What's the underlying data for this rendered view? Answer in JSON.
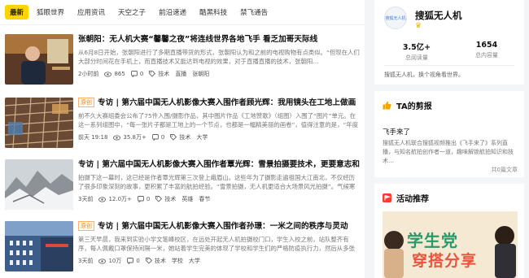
{
  "tabs": [
    {
      "label": "最新"
    },
    {
      "label": "狐眼世界"
    },
    {
      "label": "应用资讯"
    },
    {
      "label": "天空之子"
    },
    {
      "label": "前沿速递"
    },
    {
      "label": "酷黑科技"
    },
    {
      "label": "禁飞通告"
    }
  ],
  "articles": [
    {
      "badge": "",
      "title": "张朝阳：无人机大赛“馨馨之夜”将连线世界各地飞手 看乏加哥天际线",
      "summary": "从6月8日开始，张朝阳进行了多期直播带货的形式，张朝阳认为和之前的电视购物有点类似。“但现在人们大部分时间花在手机上，而直播技术又能达到电视的效果，对于直播直播的技术，张朝阳…",
      "time": "2小时前",
      "views": "865",
      "comments": "0",
      "tags": [
        "技术",
        "直播",
        "张朝阳"
      ]
    },
    {
      "badge": "原创",
      "title": "专访 | 第六届中国无人机影像大赛入围作者顾光辉：我用镜头在工地上做画",
      "summary": "前不久大赛组委会公布了75件入围/摄影作品，其中图片作品《工地赞歌》（组图）入围了“图片”单元。在这一系列组图中，“每一张片子都是工地上的一个节点，也都是一幅精美丽的画卷”，值得注意的是，“年度飞…",
      "time": "前天 19:18",
      "views": "35.8万+",
      "comments": "0",
      "tags": [
        "技术",
        "大学"
      ]
    },
    {
      "badge": "",
      "title": "专访 | 第六届中国无人机影像大赛入围作者覃光辉：雪景拍摄要技术，更要意志和毅力",
      "summary": "拍摄下这一幕时，这已经是作者覃光辉第三次登上峨眉山。这些年为了摄影走遍祖国大江南北，不仅经历了很多印象深刻的故事，更积累了丰富的航拍经验。“雪景拍摄，无人机更适合大场景风光拍摄”。气候寒冷时航拍要…",
      "time": "3天前",
      "views": "12.0万+",
      "comments": "0",
      "tags": [
        "技术",
        "英雄",
        "春节"
      ]
    },
    {
      "badge": "原创",
      "title": "专访 | 第六届中国无人机影像大赛入围作者孙璟：一米之间的秩序与灵动",
      "summary": "第三天早晨，我来到实验小学文笔峰校区，在远处开起无人机拍摄校门口，学生入校之前，站队整齐有序，每人佩戴口罩保持间隔一米，她站着学生完美的体现了学校和学生们的严格防疫执行力，然后从多张图片中，我…",
      "time": "3天前",
      "views": "10万",
      "comments": "0",
      "tags": [
        "技术",
        "学校",
        "大学"
      ]
    }
  ],
  "profile": {
    "name": "搜狐无人机",
    "avatar_text": "搜狐无人机",
    "read_value": "3.5亿+",
    "read_label": "总阅读量",
    "content_value": "1654",
    "content_label": "总内容量",
    "description": "搜狐无人机，换个视角看世界。"
  },
  "clips": {
    "heading": "TA的剪报",
    "title": "飞手来了",
    "text": "搜狐无人机联合搜狐视频推出《飞手来了》系列直播，与知名航拍创作者一道，趣味解锁航拍知识和技术…",
    "count": "共0篇文章"
  },
  "events": {
    "heading": "活动推荐",
    "banner_line1": "学生党",
    "banner_line2": "穿搭分享"
  },
  "colors": {
    "accent": "#ffd400",
    "badge": "#ff7c00",
    "events_icon": "#ff3b30",
    "clips_icon": "#f0a800"
  }
}
